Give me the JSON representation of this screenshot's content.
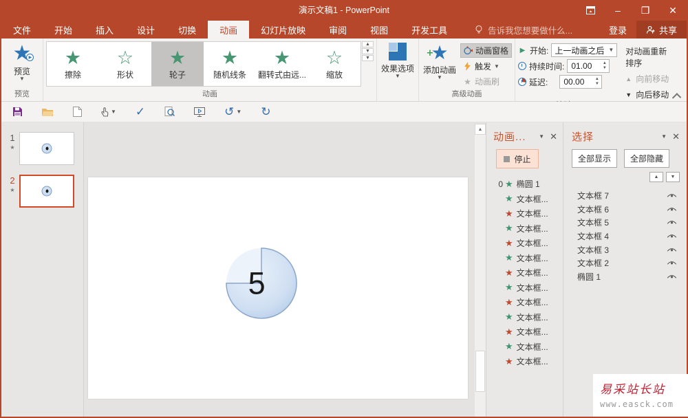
{
  "window": {
    "title": "演示文稿1 - PowerPoint"
  },
  "tabrow": {
    "tabs": [
      "文件",
      "开始",
      "插入",
      "设计",
      "切换",
      "动画",
      "幻灯片放映",
      "审阅",
      "视图",
      "开发工具"
    ],
    "active_tab": "动画",
    "tell_me": "告诉我您想要做什么...",
    "sign_in": "登录",
    "share": "共享"
  },
  "ribbon": {
    "preview": {
      "label": "预览",
      "group_label": "预览"
    },
    "gallery": {
      "group_label": "动画",
      "items": [
        {
          "label": "擦除",
          "style": "solid",
          "selected": false
        },
        {
          "label": "形状",
          "style": "outline",
          "selected": false
        },
        {
          "label": "轮子",
          "style": "solid",
          "selected": true
        },
        {
          "label": "随机线条",
          "style": "solid",
          "selected": false
        },
        {
          "label": "翻转式由远...",
          "style": "solid",
          "selected": false
        },
        {
          "label": "缩放",
          "style": "outline",
          "selected": false
        }
      ]
    },
    "effect_options": {
      "label": "效果选项"
    },
    "advanced": {
      "group_label": "高级动画",
      "add_animation": "添加动画",
      "animation_pane": "动画窗格",
      "trigger": "触发",
      "animation_painter": "动画刷"
    },
    "timing": {
      "group_label": "计时",
      "start_label": "开始:",
      "start_value": "上一动画之后",
      "duration_label": "持续时间:",
      "duration_value": "01.00",
      "delay_label": "延迟:",
      "delay_value": "00.00",
      "reorder_label": "对动画重新排序",
      "move_earlier": "向前移动",
      "move_later": "向后移动"
    }
  },
  "slides_panel": {
    "slides": [
      {
        "number": "1",
        "selected": false
      },
      {
        "number": "2",
        "selected": true
      }
    ]
  },
  "slide": {
    "countdown": "5"
  },
  "animation_pane": {
    "title": "动画...",
    "stop_label": "停止",
    "items": [
      {
        "order": "0",
        "label": "椭圆 1",
        "color": "green"
      },
      {
        "order": "",
        "label": "文本框...",
        "color": "green"
      },
      {
        "order": "",
        "label": "文本框...",
        "color": "red"
      },
      {
        "order": "",
        "label": "文本框...",
        "color": "green"
      },
      {
        "order": "",
        "label": "文本框...",
        "color": "red"
      },
      {
        "order": "",
        "label": "文本框...",
        "color": "green"
      },
      {
        "order": "",
        "label": "文本框...",
        "color": "red"
      },
      {
        "order": "",
        "label": "文本框...",
        "color": "green"
      },
      {
        "order": "",
        "label": "文本框...",
        "color": "red"
      },
      {
        "order": "",
        "label": "文本框...",
        "color": "green"
      },
      {
        "order": "",
        "label": "文本框...",
        "color": "red"
      },
      {
        "order": "",
        "label": "文本框...",
        "color": "green"
      },
      {
        "order": "",
        "label": "文本框...",
        "color": "red"
      }
    ]
  },
  "selection_pane": {
    "title": "选择",
    "show_all": "全部显示",
    "hide_all": "全部隐藏",
    "items": [
      "文本框 7",
      "文本框 6",
      "文本框 5",
      "文本框 4",
      "文本框 3",
      "文本框 2",
      "椭圆 1"
    ]
  },
  "watermark": {
    "line1": "易采站长站",
    "line2": "www.easck.com"
  }
}
